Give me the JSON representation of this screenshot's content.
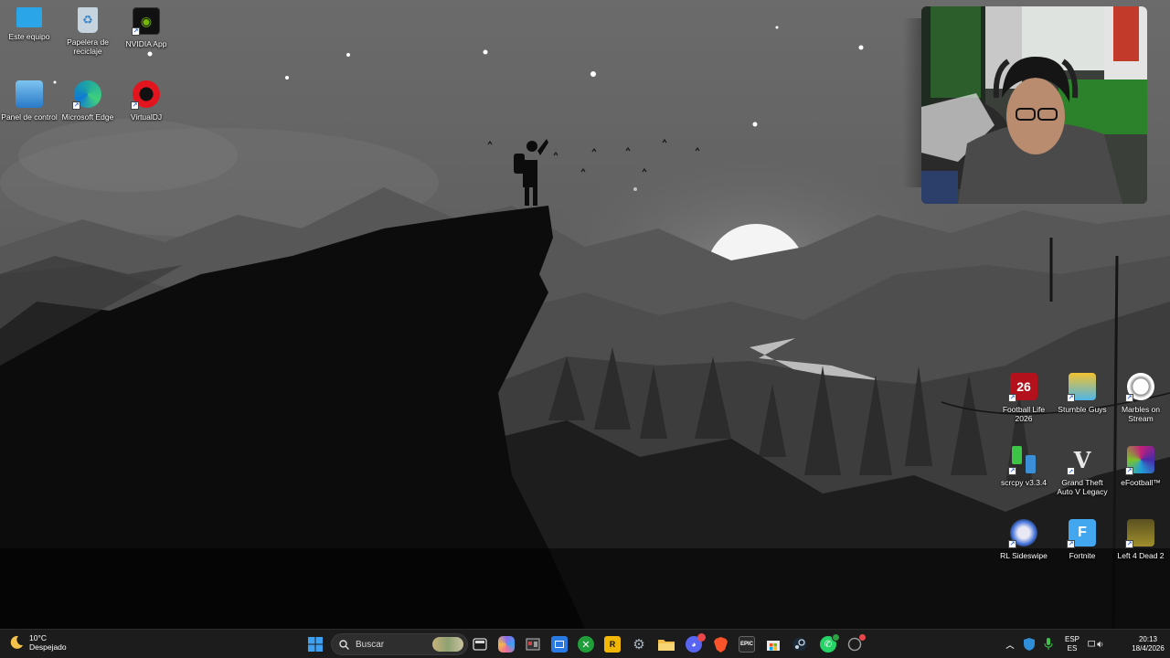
{
  "desktop": {
    "icons_left": [
      {
        "label": "Este equipo",
        "icon": "computer-icon",
        "color": "#2aa6e8"
      },
      {
        "label": "Papelera de reciclaje",
        "icon": "recycle-bin-icon",
        "color": "#c6d4e0"
      },
      {
        "label": "NVIDIA App",
        "icon": "nvidia-icon",
        "color": "#76b900"
      },
      {
        "label": "Panel de control",
        "icon": "control-panel-icon",
        "color": "#3a8fd6"
      },
      {
        "label": "Microsoft Edge",
        "icon": "edge-icon",
        "color": "#1fa6a1"
      },
      {
        "label": "VirtualDJ",
        "icon": "virtualdj-icon",
        "color": "#e2141e"
      }
    ],
    "icons_right": [
      {
        "label": "Football Life 2026",
        "icon": "football-life-icon",
        "glyph": "26",
        "color": "#b3121c"
      },
      {
        "label": "Stumble Guys",
        "icon": "stumble-guys-icon",
        "color": "#f2c230"
      },
      {
        "label": "Marbles on Stream",
        "icon": "marbles-icon",
        "color": "#f0f0f0"
      },
      {
        "label": "scrcpy v3.3.4",
        "icon": "scrcpy-icon",
        "color": "#3cc447"
      },
      {
        "label": "Grand Theft Auto V Legacy",
        "icon": "gta-v-icon",
        "glyph": "V",
        "color": "#e8e8e8"
      },
      {
        "label": "eFootball™",
        "icon": "efootball-icon",
        "color": "#c4217a"
      },
      {
        "label": "RL Sideswipe",
        "icon": "rl-sideswipe-icon",
        "color": "#3f6fd8"
      },
      {
        "label": "Fortnite",
        "icon": "fortnite-icon",
        "glyph": "F",
        "color": "#43a7f0"
      },
      {
        "label": "Left 4 Dead 2",
        "icon": "left4dead2-icon",
        "color": "#8a7a2c"
      }
    ]
  },
  "taskbar": {
    "weather": {
      "temp": "10°C",
      "condition": "Despejado",
      "icon": "moon-icon"
    },
    "search_placeholder": "Buscar",
    "apps": [
      {
        "name": "start-button",
        "icon": "windows-icon",
        "color": "#3ea0f2"
      },
      {
        "name": "task-view-button",
        "icon": "task-view-icon",
        "color": "#d8d8d8"
      },
      {
        "name": "copilot-button",
        "icon": "copilot-icon",
        "color": "#8c6cf0"
      },
      {
        "name": "app-button-1",
        "icon": "app-icon",
        "color": "#c44848"
      },
      {
        "name": "app-button-2",
        "icon": "app-icon",
        "color": "#2a7ae4"
      },
      {
        "name": "xbox-button",
        "icon": "xbox-icon",
        "color": "#1f9e3a"
      },
      {
        "name": "rockstar-button",
        "icon": "rockstar-icon",
        "color": "#f2b705"
      },
      {
        "name": "settings-button",
        "icon": "gear-icon",
        "color": "#a8b4c0"
      },
      {
        "name": "file-explorer-button",
        "icon": "folder-icon",
        "color": "#f2c04a"
      },
      {
        "name": "discord-button",
        "icon": "discord-icon",
        "color": "#5865f2"
      },
      {
        "name": "brave-button",
        "icon": "brave-icon",
        "color": "#fb542b"
      },
      {
        "name": "epic-games-button",
        "icon": "epic-games-icon",
        "color": "#2a2a2a"
      },
      {
        "name": "store-button",
        "icon": "store-icon",
        "color": "#e8e8e8"
      },
      {
        "name": "steam-button",
        "icon": "steam-icon",
        "color": "#1b2838"
      },
      {
        "name": "whatsapp-button",
        "icon": "whatsapp-icon",
        "color": "#25d366"
      },
      {
        "name": "app-button-3",
        "icon": "app-icon",
        "color": "#9a9a9a"
      }
    ],
    "epic_glyph": "EPIC",
    "rockstar_glyph": "R",
    "tray": {
      "lang_top": "ESP",
      "lang_bottom": "ES",
      "time": "20:13",
      "date": "18/4/2026"
    }
  },
  "webcam": {
    "label": "webcam-overlay"
  }
}
